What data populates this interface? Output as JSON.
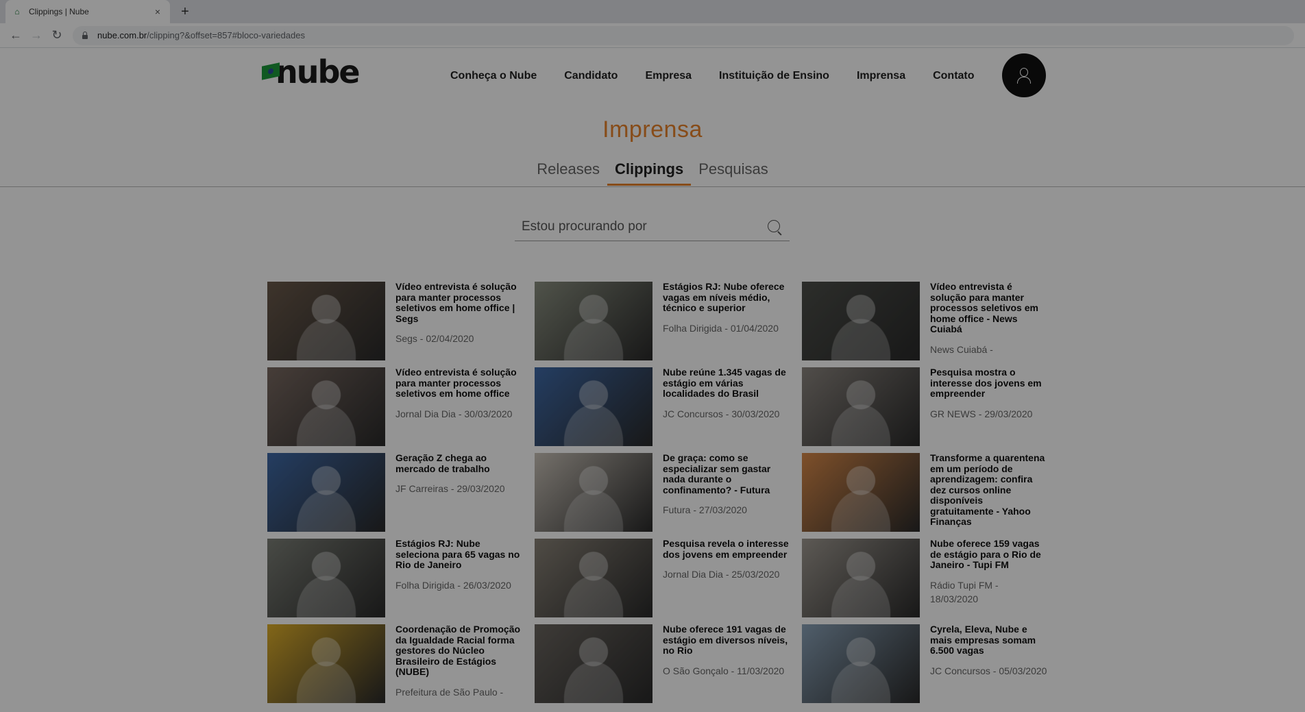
{
  "browser": {
    "tab_title": "Clippings | Nube",
    "tab_close": "×",
    "new_tab": "+",
    "url_host": "nube.com.br",
    "url_path": "/clipping?&offset=857#bloco-variedades"
  },
  "header": {
    "logo_text": "nube",
    "nav": [
      "Conheça o Nube",
      "Candidato",
      "Empresa",
      "Instituição de Ensino",
      "Imprensa",
      "Contato"
    ]
  },
  "page": {
    "title": "Imprensa",
    "tabs": [
      {
        "label": "Releases",
        "active": false
      },
      {
        "label": "Clippings",
        "active": true
      },
      {
        "label": "Pesquisas",
        "active": false
      }
    ],
    "search_placeholder": "Estou procurando por"
  },
  "clippings": [
    {
      "title": "Vídeo entrevista é solução para manter processos seletivos em home office | Segs",
      "meta": "Segs - 02/04/2020",
      "thumb": "#6b5a4b"
    },
    {
      "title": "Estágios RJ: Nube oferece vagas em níveis médio, técnico e superior",
      "meta": "Folha Dirigida - 01/04/2020",
      "thumb": "#8a8f80"
    },
    {
      "title": "Vídeo entrevista é solução para manter processos seletivos em home office - News Cuiabá",
      "meta": "News Cuiabá -",
      "thumb": "#4d4f4a"
    },
    {
      "title": "Vídeo entrevista é solução para manter processos seletivos em home office",
      "meta": "Jornal Dia Dia - 30/03/2020",
      "thumb": "#7a6a62"
    },
    {
      "title": "Nube reúne 1.345 vagas de estágio em várias localidades do Brasil",
      "meta": "JC Concursos - 30/03/2020",
      "thumb": "#3f6aa8"
    },
    {
      "title": "Pesquisa mostra o interesse dos jovens em empreender",
      "meta": "GR NEWS - 29/03/2020",
      "thumb": "#8c8680"
    },
    {
      "title": "Geração Z chega ao mercado de trabalho",
      "meta": "JF Carreiras - 29/03/2020",
      "thumb": "#3f6aa8"
    },
    {
      "title": "De graça: como se especializar sem gastar nada durante o confinamento? - Futura",
      "meta": "Futura - 27/03/2020",
      "thumb": "#c9c2b8"
    },
    {
      "title": "Transforme a quarentena em um período de aprendizagem: confira dez cursos online disponíveis gratuitamente - Yahoo Finanças",
      "meta": "",
      "thumb": "#d98a4a"
    },
    {
      "title": "Estágios RJ: Nube seleciona para 65 vagas no Rio de Janeiro",
      "meta": "Folha Dirigida - 26/03/2020",
      "thumb": "#7d8078"
    },
    {
      "title": "Pesquisa revela o interesse dos jovens em empreender",
      "meta": "Jornal Dia Dia - 25/03/2020",
      "thumb": "#8a8378"
    },
    {
      "title": "Nube oferece 159 vagas de estágio para o Rio de Janeiro - Tupi FM",
      "meta": "Rádio Tupi FM - 18/03/2020",
      "thumb": "#a09a92"
    },
    {
      "title": "Coordenação de Promoção da Igualdade Racial forma gestores do Núcleo Brasileiro de Estágios (NUBE)",
      "meta": "Prefeitura de São Paulo -",
      "thumb": "#e0b02a"
    },
    {
      "title": "Nube oferece 191 vagas de estágio em diversos níveis, no Rio",
      "meta": "O São Gonçalo - 11/03/2020",
      "thumb": "#6b6660"
    },
    {
      "title": "Cyrela, Eleva, Nube e mais empresas somam 6.500 vagas",
      "meta": "JC Concursos - 05/03/2020",
      "thumb": "#8aa2b8"
    }
  ]
}
